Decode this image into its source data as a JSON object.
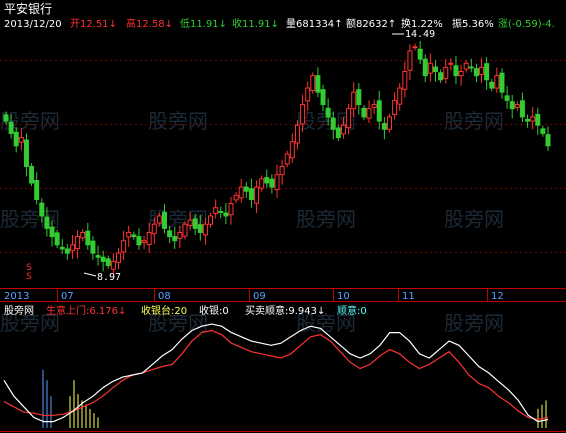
{
  "colors": {
    "background": "#000000",
    "up": "#ff3232",
    "down": "#33cc33",
    "grid": "#7a0000",
    "axis": "#c00000",
    "white": "#ffffff",
    "yellow": "#ffff55",
    "cyan": "#55ffff",
    "blue": "#5aa0ff",
    "marker": "#ff3030"
  },
  "header": {
    "stock_name": "平安银行",
    "date": "2013/12/20",
    "open_label": "开",
    "open_value": "12.51",
    "high_label": "高",
    "high_value": "12.58",
    "low_label": "低",
    "low_value": "11.91",
    "close_label": "收",
    "close_value": "11.91",
    "volume_label": "量",
    "volume_value": "681334",
    "amount_label": "额",
    "amount_value": "82632",
    "turnover_label": "换",
    "turnover_value": "1.22%",
    "amplitude_label": "振",
    "amplitude_value": "5.36%",
    "change_label": "涨",
    "change_value": "(-0.59)-4.",
    "down_arrow": "↓",
    "up_arrow": "↑"
  },
  "annotations": {
    "max_price": "14.49",
    "min_price": "8.97",
    "marker": "S"
  },
  "x_axis": {
    "labels": [
      "2013",
      "07",
      "08",
      "09",
      "10",
      "11",
      "12"
    ]
  },
  "indicator_header": {
    "name": "股旁网",
    "shangxia_label": "生意上门:",
    "shangxia_value": "6.176",
    "shouyintai_label": "收银台:",
    "shouyintai_value": "20",
    "shouyin_label": "收银:",
    "shouyin_value": "0",
    "maimai_label": "买卖顺意:",
    "maimai_value": "9.943",
    "shunyi_label": "顺意:",
    "shunyi_value": "0",
    "arrow": "↓"
  },
  "watermark": "股旁网",
  "chart_data": [
    {
      "type": "candlestick",
      "title": "平安银行",
      "x_labels": [
        "2013",
        "07",
        "08",
        "09",
        "10",
        "11",
        "12"
      ],
      "price_max": 14.49,
      "price_min": 8.97,
      "last_bar": {
        "date": "2013/12/20",
        "open": 12.51,
        "high": 12.58,
        "low": 11.91,
        "close": 11.91
      },
      "grid": true,
      "close_series": [
        12.5,
        12.2,
        11.9,
        12.1,
        11.4,
        11.0,
        10.6,
        10.2,
        9.9,
        9.7,
        9.5,
        9.4,
        9.3,
        9.5,
        9.7,
        9.8,
        9.5,
        9.3,
        9.2,
        9.1,
        9.0,
        9.1,
        9.3,
        9.6,
        9.8,
        9.7,
        9.5,
        9.6,
        9.8,
        10.0,
        10.2,
        9.9,
        9.7,
        9.6,
        9.8,
        10.0,
        10.1,
        9.9,
        9.8,
        10.0,
        10.2,
        10.4,
        10.3,
        10.2,
        10.5,
        10.7,
        10.9,
        10.8,
        10.6,
        10.9,
        11.1,
        11.0,
        10.9,
        11.2,
        11.4,
        11.7,
        12.0,
        12.4,
        12.9,
        13.3,
        13.6,
        13.2,
        12.9,
        12.6,
        12.3,
        12.1,
        12.4,
        12.8,
        13.2,
        12.9,
        12.6,
        12.8,
        12.9,
        12.5,
        12.3,
        12.6,
        13.0,
        13.3,
        13.7,
        14.2,
        14.3,
        14.0,
        13.6,
        13.9,
        13.7,
        13.5,
        13.8,
        13.9,
        13.6,
        13.7,
        13.9,
        13.8,
        13.6,
        13.8,
        13.5,
        13.3,
        13.6,
        13.2,
        13.0,
        12.8,
        12.9,
        12.6,
        12.5,
        12.6,
        12.4,
        12.2,
        11.9
      ]
    },
    {
      "type": "line",
      "title": "股旁网",
      "series": [
        {
          "name": "生意上门",
          "color": "#ff3232",
          "values": [
            0.25,
            0.2,
            0.15,
            0.14,
            0.12,
            0.12,
            0.13,
            0.16,
            0.2,
            0.24,
            0.3,
            0.38,
            0.45,
            0.5,
            0.52,
            0.55,
            0.58,
            0.6,
            0.7,
            0.82,
            0.9,
            0.92,
            0.88,
            0.8,
            0.76,
            0.72,
            0.7,
            0.68,
            0.66,
            0.7,
            0.78,
            0.86,
            0.88,
            0.82,
            0.72,
            0.62,
            0.56,
            0.6,
            0.68,
            0.74,
            0.7,
            0.62,
            0.56,
            0.6,
            0.66,
            0.72,
            0.62,
            0.5,
            0.42,
            0.38,
            0.3,
            0.24,
            0.16,
            0.1,
            0.08,
            0.1
          ]
        },
        {
          "name": "买卖顺意",
          "color": "#ffffff",
          "values": [
            0.45,
            0.3,
            0.2,
            0.1,
            0.06,
            0.06,
            0.1,
            0.16,
            0.24,
            0.3,
            0.38,
            0.44,
            0.48,
            0.5,
            0.52,
            0.6,
            0.68,
            0.74,
            0.84,
            0.92,
            0.96,
            0.98,
            0.96,
            0.9,
            0.86,
            0.82,
            0.8,
            0.78,
            0.8,
            0.86,
            0.92,
            0.96,
            0.94,
            0.86,
            0.78,
            0.7,
            0.66,
            0.7,
            0.78,
            0.9,
            0.9,
            0.82,
            0.7,
            0.66,
            0.74,
            0.82,
            0.78,
            0.68,
            0.58,
            0.52,
            0.44,
            0.36,
            0.26,
            0.12,
            0.06,
            0.08
          ]
        }
      ]
    }
  ]
}
